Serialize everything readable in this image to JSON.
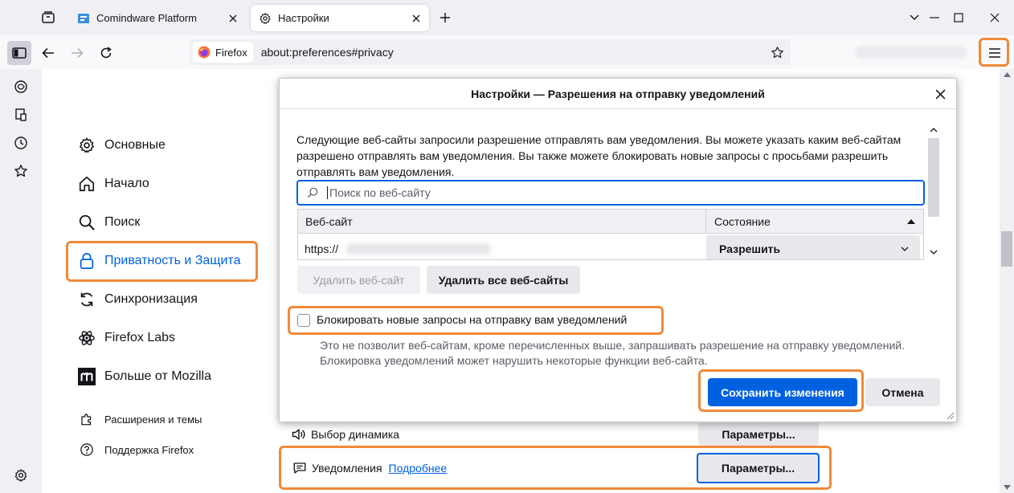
{
  "tabs": [
    {
      "label": "Comindware Platform",
      "active": false
    },
    {
      "label": "Настройки",
      "active": true
    }
  ],
  "nav": {
    "identity_label": "Firefox",
    "url": "about:preferences#privacy"
  },
  "categories": [
    {
      "label": "Основные",
      "icon": "gear-icon"
    },
    {
      "label": "Начало",
      "icon": "home-icon"
    },
    {
      "label": "Поиск",
      "icon": "search-icon"
    },
    {
      "label": "Приватность и Защита",
      "icon": "lock-icon"
    },
    {
      "label": "Синхронизация",
      "icon": "sync-icon"
    },
    {
      "label": "Firefox Labs",
      "icon": "flask-icon"
    },
    {
      "label": "Больше от Mozilla",
      "icon": "mozilla-icon"
    }
  ],
  "footer_links": [
    {
      "label": "Расширения и темы",
      "icon": "puzzle-icon"
    },
    {
      "label": "Поддержка Firefox",
      "icon": "help-icon"
    }
  ],
  "dialog": {
    "title": "Настройки — Разрешения на отправку уведомлений",
    "description": "Следующие веб-сайты запросили разрешение отправлять вам уведомления. Вы можете указать каким веб-сайтам разрешено отправлять вам уведомления. Вы также можете блокировать новые запросы с просьбами разрешить отправлять вам уведомления.",
    "search_placeholder": "Поиск по веб-сайту",
    "col_site": "Веб-сайт",
    "col_status": "Состояние",
    "row_site": "https://",
    "row_status": "Разрешить",
    "remove_site": "Удалить веб-сайт",
    "remove_all": "Удалить все веб-сайты",
    "block_label": "Блокировать новые запросы на отправку вам уведомлений",
    "block_desc": "Это не позволит веб-сайтам, кроме перечисленных выше, запрашивать разрешение на отправку уведомлений. Блокировка уведомлений может нарушить некоторые функции веб-сайта.",
    "save": "Сохранить изменения",
    "cancel": "Отмена"
  },
  "prefs": {
    "speaker_label": "Выбор динамика",
    "speaker_button": "Параметры...",
    "notifications_label": "Уведомления",
    "notifications_link": "Подробнее",
    "notifications_button": "Параметры..."
  },
  "colors": {
    "accent": "#0061e0",
    "highlight": "#f08a3a"
  }
}
